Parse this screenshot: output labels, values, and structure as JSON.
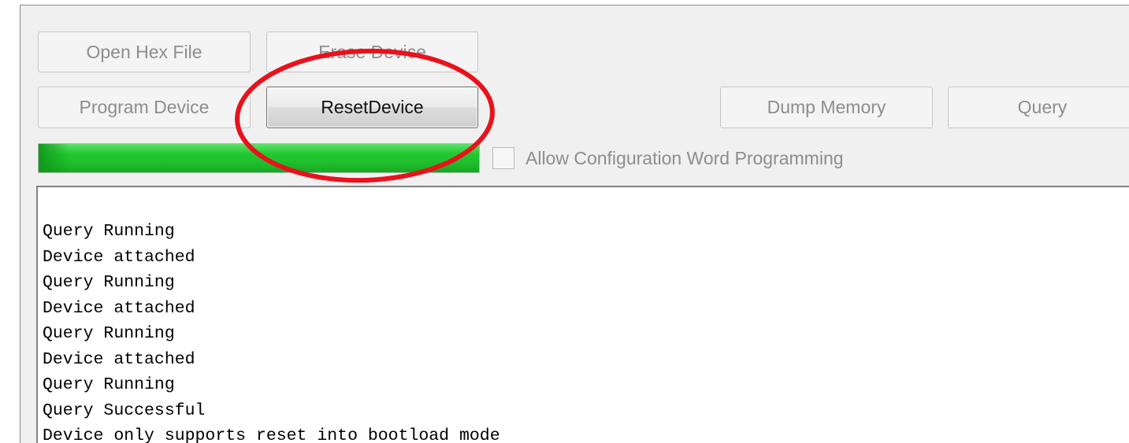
{
  "toolbar": {
    "open_hex_file": "Open Hex File",
    "erase_device": "Erase Device",
    "program_device": "Program Device",
    "reset_device": "ResetDevice",
    "dump_memory": "Dump Memory",
    "query": "Query"
  },
  "progress": {
    "value_fraction": 1.0,
    "color": "#22c930"
  },
  "config_option": {
    "label": "Allow Configuration Word Programming",
    "checked": false
  },
  "log": {
    "lines": [
      "Query Running",
      "Device attached",
      "Query Running",
      "Device attached",
      "Query Running",
      "Device attached",
      "Query Running",
      "Query Successful",
      "Device only supports reset into bootload mode"
    ]
  },
  "annotation": {
    "shape": "ellipse",
    "color": "#e8121c",
    "target": "reset-device-button"
  }
}
